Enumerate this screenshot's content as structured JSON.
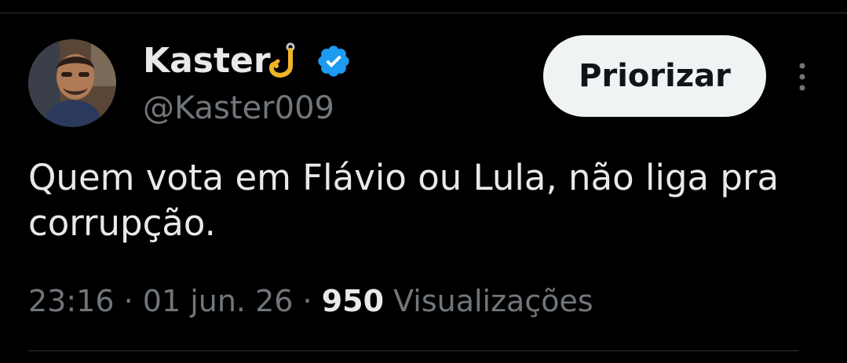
{
  "author": {
    "display_name": "Kaster",
    "handle": "@Kaster009",
    "hook_icon": "hook-icon",
    "verified_icon": "verified-badge-icon",
    "verified_color": "#1d9bf0"
  },
  "actions": {
    "prioritize_label": "Priorizar",
    "more_icon": "more-vertical-icon"
  },
  "tweet": {
    "text": "Quem vota em Flávio ou Lula, não liga pra corrupção."
  },
  "meta": {
    "time": "23:16",
    "separator": " · ",
    "date": "01 jun. 26",
    "views_count": "950",
    "views_label": " Visualizações"
  },
  "colors": {
    "background": "#000000",
    "text_primary": "#e7e9ea",
    "text_secondary": "#71767b",
    "button_bg": "#eff3f4",
    "button_text": "#0f1419",
    "divider": "#2f3336"
  }
}
